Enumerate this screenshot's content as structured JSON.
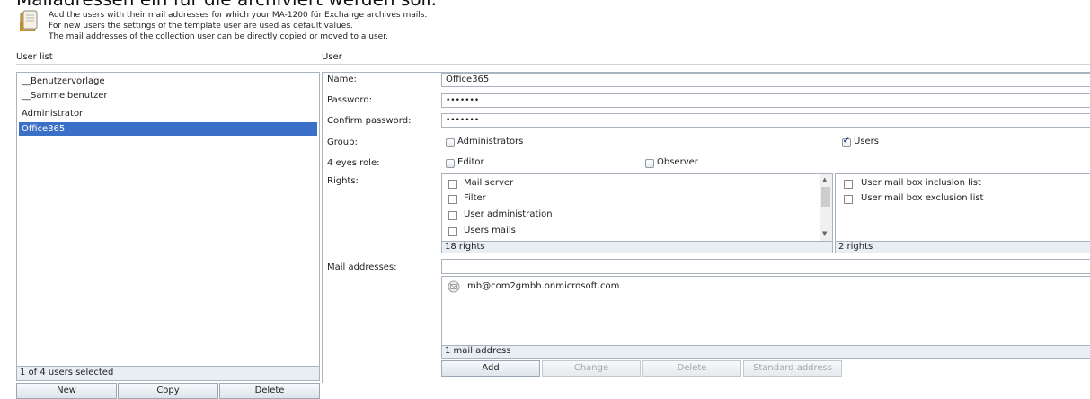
{
  "heading_cut": "Mailadressen ein für die archiviert werden soll.",
  "info": {
    "lines": [
      "Add the users with their mail addresses for which your MA-1200 für Exchange archives mails.",
      "For new users the settings of the template user are used as default values.",
      "The mail addresses of the collection user can be directly copied or moved to a user."
    ]
  },
  "user_list": {
    "title": "User list",
    "items": [
      {
        "label": "__Benutzervorlage"
      },
      {
        "label": "__Sammelbenutzer"
      },
      {
        "label": "Administrator"
      },
      {
        "label": "Office365"
      }
    ],
    "selected_index": 3,
    "status": "1 of 4 users selected",
    "buttons": {
      "new": "New",
      "copy": "Copy",
      "delete": "Delete"
    }
  },
  "user": {
    "title": "User",
    "name_label": "Name:",
    "name_value": "Office365",
    "password_label": "Password:",
    "password_value": "•••••••",
    "confirm_label": "Confirm password:",
    "confirm_value": "•••••••",
    "group_label": "Group:",
    "groups": [
      {
        "label": "Administrators",
        "checked": false
      },
      {
        "label": "Users",
        "checked": true
      }
    ],
    "eyes_label": "4 eyes role:",
    "eyes_roles": [
      {
        "label": "Editor",
        "checked": false
      },
      {
        "label": "Observer",
        "checked": false
      }
    ],
    "rights_label": "Rights:",
    "rights": [
      {
        "label": "Mail server",
        "checked": false
      },
      {
        "label": "Filter",
        "checked": false
      },
      {
        "label": "User administration",
        "checked": false
      },
      {
        "label": "Users mails",
        "checked": false
      }
    ],
    "rights_count": "18 rights",
    "extra_rights": [
      {
        "label": "User mail box inclusion list",
        "checked": false
      },
      {
        "label": "User mail box exclusion list",
        "checked": false
      }
    ],
    "extra_rights_count": "2 rights",
    "mail_label": "Mail addresses:",
    "mail_input_value": "",
    "mail_addresses": [
      "mb@com2gmbh.onmicrosoft.com"
    ],
    "mail_count": "1 mail address",
    "mail_buttons": {
      "add": "Add",
      "change": "Change",
      "delete": "Delete",
      "standard": "Standard address"
    }
  },
  "colors": {
    "selection": "#3a70c8",
    "border": "#a9b3bd",
    "status_bg": "#e9eef4"
  },
  "icons": {
    "info": "notebook-icon",
    "mail": "envelope-icon"
  }
}
